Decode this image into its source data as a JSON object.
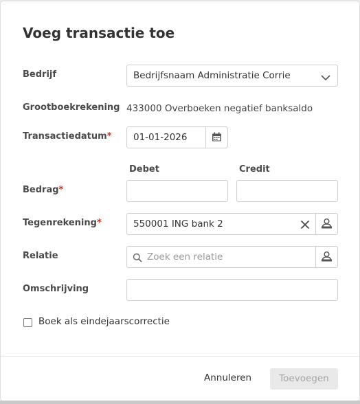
{
  "dialog": {
    "title": "Voeg transactie toe",
    "fields": {
      "bedrijf": {
        "label": "Bedrijf",
        "value": "Bedrijfsnaam Administratie Corrie"
      },
      "grootboek": {
        "label": "Grootboekrekening",
        "value": "433000 Overboeken negatief banksaldo"
      },
      "datum": {
        "label": "Transactiedatum",
        "required_mark": "*",
        "value": "01-01-2026"
      },
      "bedrag": {
        "label": "Bedrag",
        "required_mark": "*",
        "debet_label": "Debet",
        "credit_label": "Credit",
        "debet_value": "",
        "credit_value": ""
      },
      "tegenrekening": {
        "label": "Tegenrekening",
        "required_mark": "*",
        "value": "550001 ING bank 2"
      },
      "relatie": {
        "label": "Relatie",
        "placeholder": "Zoek een relatie"
      },
      "omschrijving": {
        "label": "Omschrijving",
        "value": ""
      },
      "eindejaar": {
        "label": "Boek als eindejaarscorrectie",
        "checked": false
      }
    },
    "footer": {
      "cancel_label": "Annuleren",
      "submit_label": "Toevoegen"
    }
  },
  "colors": {
    "required": "#c0392b",
    "disabled_bg": "#e9e9e9",
    "disabled_text": "#a5a5a5"
  },
  "icons": [
    "chevron-down-icon",
    "calendar-icon",
    "clear-icon",
    "person-picker-icon",
    "search-icon"
  ]
}
